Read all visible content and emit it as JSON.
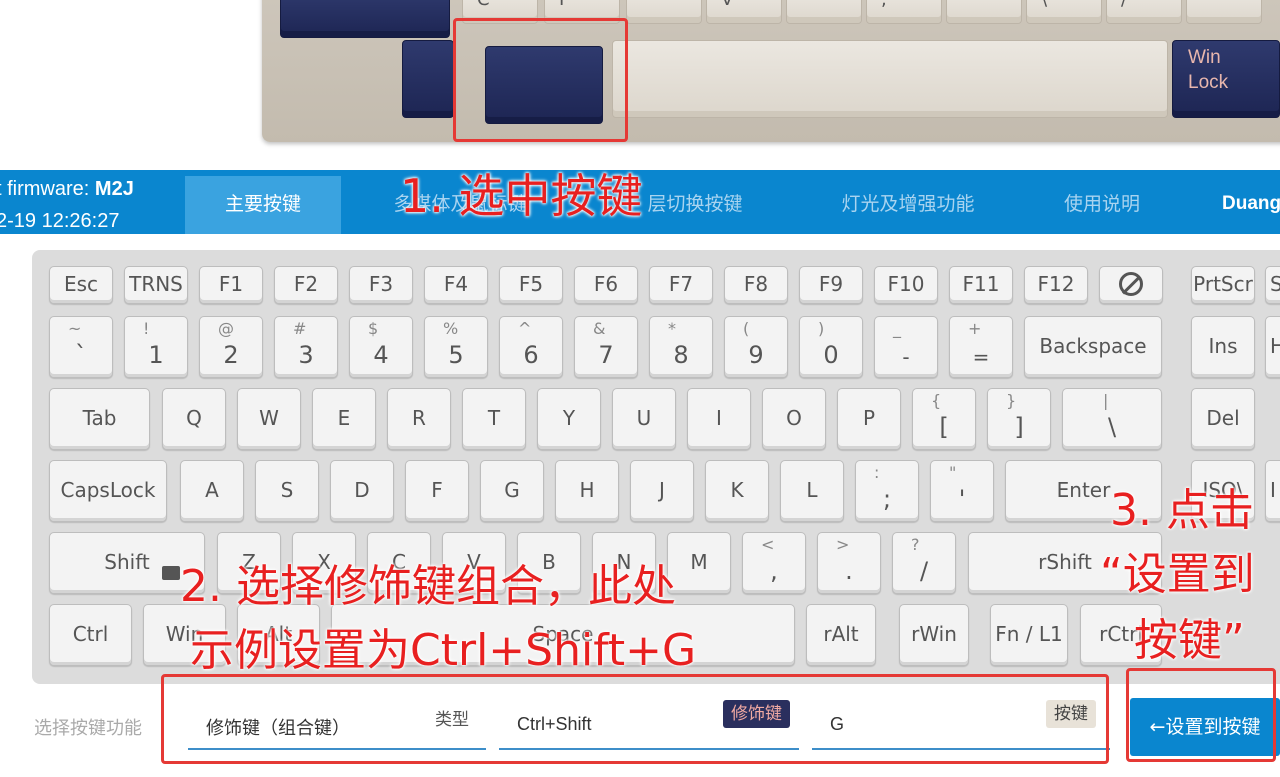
{
  "photo": {
    "keys_row1": [
      "C",
      "F",
      "",
      "V",
      "",
      ";",
      "",
      "\\",
      "/",
      "",
      ""
    ],
    "winlock_label": "Win\nLock"
  },
  "header": {
    "firmware_label": "t firmware: ",
    "firmware_value": "M2J",
    "timestamp": "2-19 12:26:27",
    "tabs": [
      "主要按键",
      "多媒体及鼠标键",
      "层切换按键",
      "灯光及增强功能",
      "使用说明",
      "Duang"
    ],
    "active_tab": "主要按键"
  },
  "keyboard": {
    "row0": [
      "Esc",
      "TRNS",
      "F1",
      "F2",
      "F3",
      "F4",
      "F5",
      "F6",
      "F7",
      "F8",
      "F9",
      "F10",
      "F11",
      "F12",
      "⊘",
      "PrtScr",
      "S"
    ],
    "row1": [
      {
        "shift": "~",
        "main": "`"
      },
      {
        "shift": "!",
        "main": "1"
      },
      {
        "shift": "@",
        "main": "2"
      },
      {
        "shift": "#",
        "main": "3"
      },
      {
        "shift": "$",
        "main": "4"
      },
      {
        "shift": "%",
        "main": "5"
      },
      {
        "shift": "^",
        "main": "6"
      },
      {
        "shift": "&",
        "main": "7"
      },
      {
        "shift": "*",
        "main": "8"
      },
      {
        "shift": "(",
        "main": "9"
      },
      {
        "shift": ")",
        "main": "0"
      },
      {
        "shift": "_",
        "main": "-"
      },
      {
        "shift": "+",
        "main": "="
      }
    ],
    "backspace": "Backspace",
    "ins": "Ins",
    "h_edge": "H",
    "tab": "Tab",
    "row2": [
      "Q",
      "W",
      "E",
      "R",
      "T",
      "Y",
      "U",
      "I",
      "O",
      "P"
    ],
    "row2_sym": [
      {
        "shift": "{",
        "main": "["
      },
      {
        "shift": "}",
        "main": "]"
      },
      {
        "shift": "|",
        "main": "\\"
      }
    ],
    "del": "Del",
    "capslock": "CapsLock",
    "row3": [
      "A",
      "S",
      "D",
      "F",
      "G",
      "H",
      "J",
      "K",
      "L"
    ],
    "row3_sym": [
      {
        "shift": ":",
        "main": ";"
      },
      {
        "shift": "\"",
        "main": "'"
      }
    ],
    "enter": "Enter",
    "iso": "ISO\\",
    "i_edge": "I",
    "shift": "Shift",
    "row4": [
      "Z",
      "X",
      "C",
      "V",
      "B",
      "N",
      "M"
    ],
    "row4_sym": [
      {
        "shift": "<",
        "main": ","
      },
      {
        "shift": ">",
        "main": "."
      },
      {
        "shift": "?",
        "main": "/"
      }
    ],
    "rshift": "rShift",
    "ctrl": "Ctrl",
    "lwin": "Win",
    "lalt": "Alt",
    "space": "Space",
    "ralt": "rAlt",
    "rwin": "rWin",
    "fn": "Fn / L1",
    "rctrl": "rCtrl"
  },
  "bottom": {
    "func_label": "选择按键功能",
    "func_value": "修饰键（组合键）",
    "type_label": "类型",
    "modifier_value": "Ctrl+Shift",
    "modifier_badge": "修饰键",
    "key_value": "G",
    "key_badge": "按键",
    "set_button": "←设置到按键"
  },
  "annotations": {
    "step1": "1. 选中按键",
    "step2_line1": "2. 选择修饰键组合，此处",
    "step2_line2": "示例设置为Ctrl+Shift+G",
    "step3_line1": "3. 点击",
    "step3_line2": "“设置到",
    "step3_line3": "按键”"
  },
  "colors": {
    "nav_blue": "#0a86cf",
    "active_tab": "#3aa3e0",
    "annotation_red": "#e53935",
    "key_navy": "#1d2553",
    "key_beige": "#e6e1d8"
  }
}
